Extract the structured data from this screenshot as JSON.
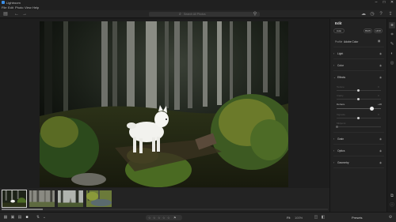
{
  "window": {
    "title": "Lightroom",
    "controls": {
      "minimize": "–",
      "maximize": "□",
      "close": "✕"
    }
  },
  "menu": [
    "File",
    "Edit",
    "Photo",
    "View",
    "Help"
  ],
  "toolbar": {
    "search_placeholder": "Search All Photos",
    "icons": [
      "sidebar-toggle-icon",
      "undo-icon",
      "redo-icon",
      "filter-icon",
      "cloud-sync-icon",
      "notifications-icon",
      "help-icon",
      "share-icon"
    ]
  },
  "filmstrip": {
    "thumbnails": [
      "dog-forest",
      "misty-forest",
      "forest-path",
      "forest-pond"
    ],
    "active_index": 0
  },
  "bottombar": {
    "view_icons": [
      "grid-view-icon",
      "square-grid-icon",
      "detail-view-icon",
      "single-view-icon"
    ],
    "fit_label": "Fit",
    "zoom_label": "100%",
    "presets_label": "Presets"
  },
  "panel": {
    "title": "Edit",
    "auto_label": "Auto",
    "bw_label": "B&W",
    "hdr_label": "HDR",
    "profile_label": "Profile",
    "profile_value": "Adobe Color",
    "sections": {
      "light": "Light",
      "color": "Color",
      "effects": "Effects",
      "grain": "Grain",
      "optics": "Optics",
      "geometry": "Geometry"
    },
    "effects_sliders": [
      {
        "label": "Texture",
        "value": "0",
        "pos": 0.5,
        "dim": true
      },
      {
        "label": "Clarity",
        "value": "0",
        "pos": 0.5,
        "dim": true
      },
      {
        "label": "Dehaze",
        "value": "+20",
        "pos": 0.6,
        "dim": false
      },
      {
        "label": "Vignette",
        "value": "0",
        "pos": 0.5,
        "dim": true
      },
      {
        "label": "Midpoint",
        "value": "",
        "pos": 0.0,
        "dim": true
      }
    ]
  },
  "iconstrip": [
    "edit-icon",
    "crop-icon",
    "healing-icon",
    "masking-icon",
    "red-eye-icon",
    "presets-icon",
    "versions-icon",
    "info-icon"
  ]
}
